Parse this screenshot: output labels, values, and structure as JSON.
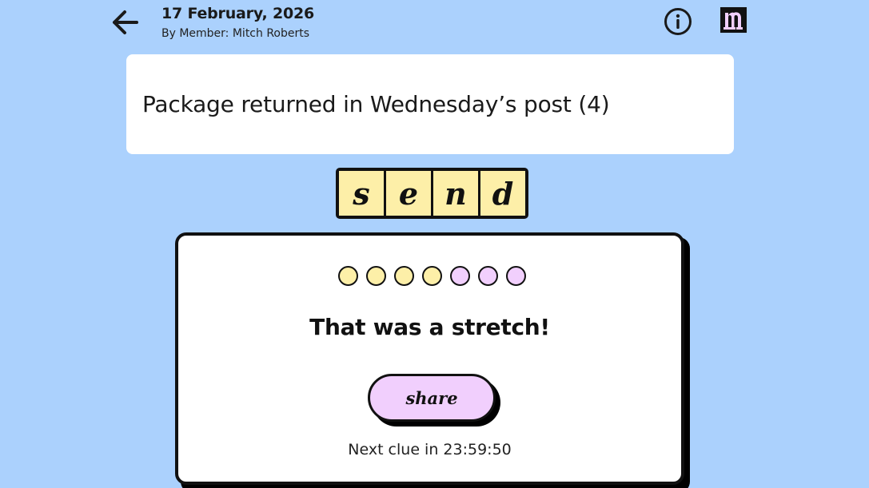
{
  "header": {
    "date": "17 February, 2026",
    "byline": "By Member: Mitch Roberts",
    "back_icon": "arrow-left-icon",
    "info_icon": "info-icon",
    "logo_icon": "n-logo-icon"
  },
  "clue": {
    "text": "Package returned in Wednesday’s post (4)"
  },
  "answer": {
    "letters": [
      "s",
      "e",
      "n",
      "d"
    ]
  },
  "result": {
    "attempts": [
      {
        "state": "used",
        "color": "#fdefa8"
      },
      {
        "state": "used",
        "color": "#fdefa8"
      },
      {
        "state": "used",
        "color": "#fdefa8"
      },
      {
        "state": "used",
        "color": "#fdefa8"
      },
      {
        "state": "unused",
        "color": "#f1cffd"
      },
      {
        "state": "unused",
        "color": "#f1cffd"
      },
      {
        "state": "unused",
        "color": "#f1cffd"
      }
    ],
    "title": "That was a stretch!",
    "share_label": "share",
    "next_clue": "Next clue in 23:59:50"
  },
  "colors": {
    "background": "#abd1fd",
    "tile": "#fdefa8",
    "share": "#f1cffd"
  }
}
